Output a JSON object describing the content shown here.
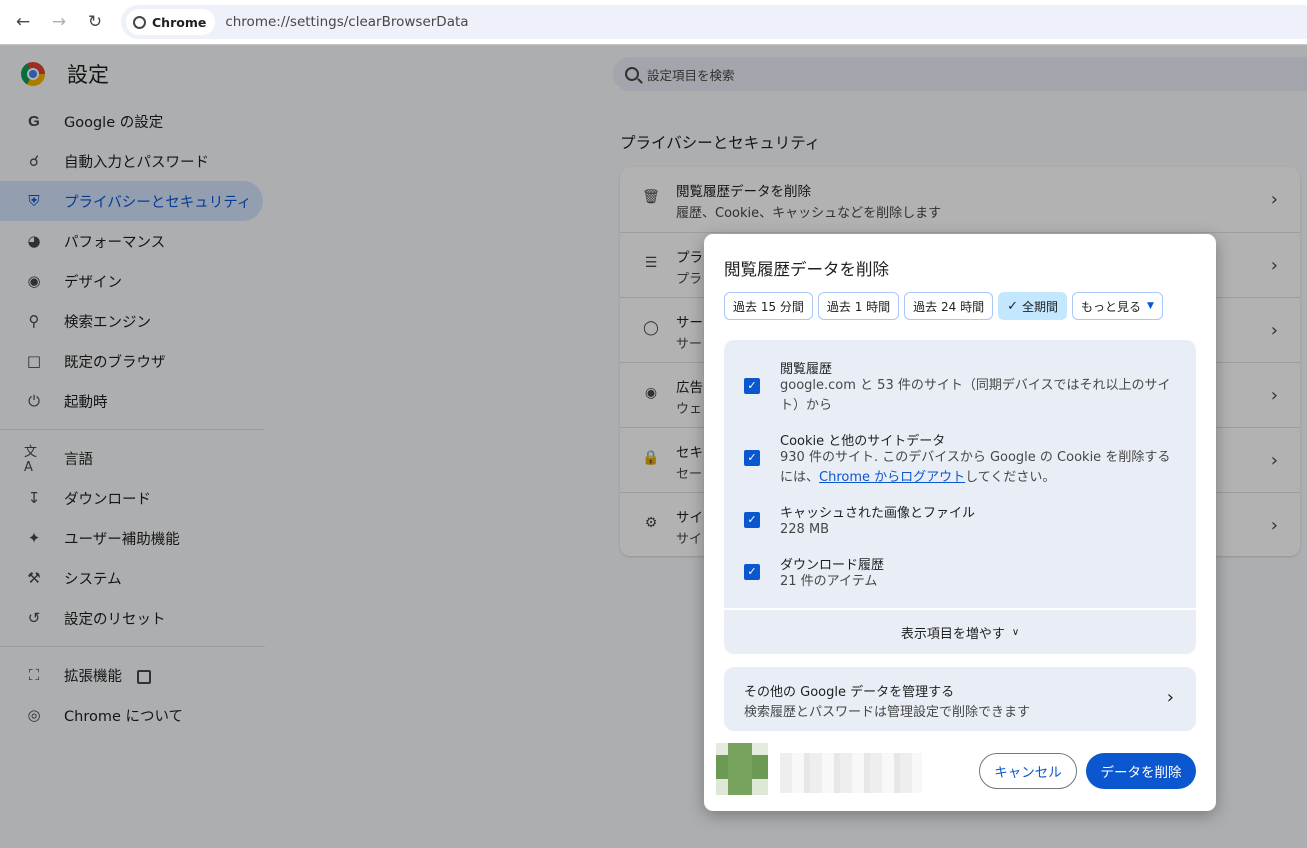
{
  "browser": {
    "chip_label": "Chrome",
    "url": "chrome://settings/clearBrowserData"
  },
  "settings": {
    "title": "設定",
    "search_placeholder": "設定項目を検索",
    "sidebar": [
      {
        "label": "Google の設定",
        "icon": "google-icon"
      },
      {
        "label": "自動入力とパスワード",
        "icon": "key-icon"
      },
      {
        "label": "プライバシーとセキュリティ",
        "icon": "shield-icon",
        "active": true
      },
      {
        "label": "パフォーマンス",
        "icon": "speedometer-icon"
      },
      {
        "label": "デザイン",
        "icon": "palette-icon"
      },
      {
        "label": "検索エンジン",
        "icon": "search-icon"
      },
      {
        "label": "既定のブラウザ",
        "icon": "browser-window-icon"
      },
      {
        "label": "起動時",
        "icon": "power-icon"
      },
      {
        "label": "言語",
        "icon": "translate-icon"
      },
      {
        "label": "ダウンロード",
        "icon": "download-icon"
      },
      {
        "label": "ユーザー補助機能",
        "icon": "accessibility-icon"
      },
      {
        "label": "システム",
        "icon": "wrench-icon"
      },
      {
        "label": "設定のリセット",
        "icon": "reset-icon"
      },
      {
        "label": "拡張機能",
        "icon": "extension-icon"
      },
      {
        "label": "Chrome について",
        "icon": "chrome-icon"
      }
    ],
    "section_title": "プライバシーとセキュリティ",
    "rows": [
      {
        "title": "閲覧履歴データを削除",
        "desc": "履歴、Cookie、キャッシュなどを削除します",
        "icon": "trash-icon"
      },
      {
        "title": "プラ",
        "desc": "プラ",
        "icon": "privacy-guide-icon"
      },
      {
        "title": "サー",
        "desc": "サー",
        "icon": "cookie-icon"
      },
      {
        "title": "広告",
        "desc": "ウェ",
        "icon": "ad-privacy-icon"
      },
      {
        "title": "セキ",
        "desc": "セー",
        "icon": "lock-icon"
      },
      {
        "title": "サイ",
        "desc": "サイ",
        "icon": "sliders-icon"
      }
    ]
  },
  "dialog": {
    "title": "閲覧履歴データを削除",
    "tabs": [
      {
        "label": "過去 15 分間",
        "selected": false
      },
      {
        "label": "過去 1 時間",
        "selected": false
      },
      {
        "label": "過去 24 時間",
        "selected": false
      },
      {
        "label": "全期間",
        "selected": true
      },
      {
        "label": "もっと見る",
        "selected": false
      }
    ],
    "items": [
      {
        "title": "閲覧履歴",
        "desc": "google.com と 53 件のサイト（同期デバイスではそれ以上のサイト）から",
        "checked": true
      },
      {
        "title": "Cookie と他のサイトデータ",
        "desc_before": "930 件のサイト. このデバイスから Google の Cookie を削除するには、",
        "link": "Chrome からログアウト",
        "desc_after": "してください。",
        "checked": true
      },
      {
        "title": "キャッシュされた画像とファイル",
        "desc": "228 MB",
        "checked": true
      },
      {
        "title": "ダウンロード履歴",
        "desc": "21 件のアイテム",
        "checked": true
      }
    ],
    "show_more": "表示項目を増やす",
    "manage_title": "その他の Google データを管理する",
    "manage_desc": "検索履歴とパスワードは管理設定で削除できます",
    "cancel": "キャンセル",
    "delete": "データを削除",
    "accent_color": "#0b57d0"
  }
}
